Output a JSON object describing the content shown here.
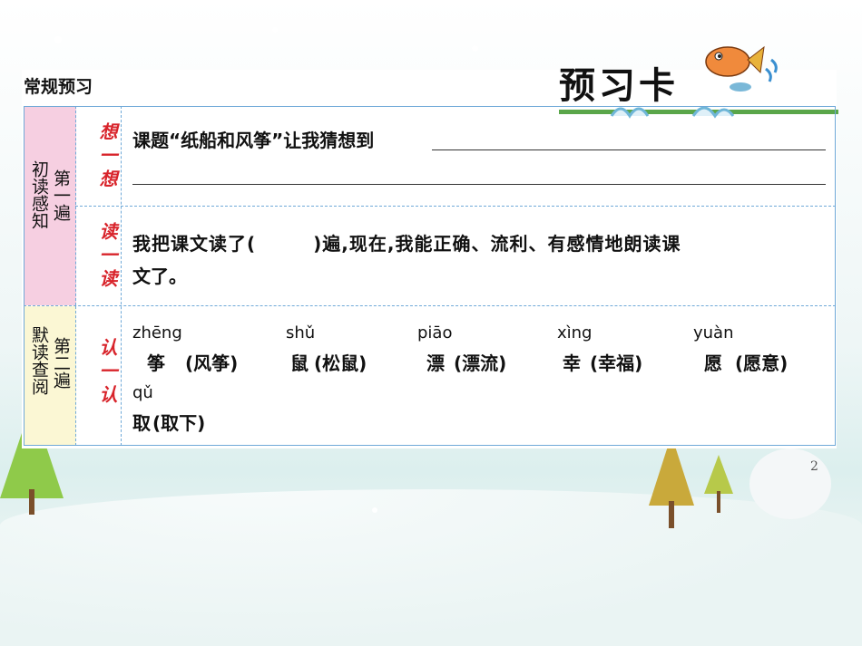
{
  "header": {
    "section_label": "常规预习",
    "title_logo": "预习卡"
  },
  "rows": {
    "pass1": {
      "label": "第一遍",
      "sublabel": "初读感知"
    },
    "pass2": {
      "label": "第二遍",
      "sublabel": "默读查阅"
    },
    "think": {
      "label": "想一想",
      "text": "课题“纸船和风筝”让我猜想到"
    },
    "read": {
      "label": "读一读",
      "line1": "我把课文读了(　　　)遍,现在,我能正确、流利、有感情地朗读课",
      "line2": "文了。"
    },
    "recognize": {
      "label": "认一认",
      "items": [
        {
          "pinyin": "zhēng",
          "char": "筝",
          "word": "(风筝)"
        },
        {
          "pinyin": "shǔ",
          "char": "鼠",
          "word": "(松鼠)"
        },
        {
          "pinyin": "piāo",
          "char": "漂",
          "word": "(漂流)"
        },
        {
          "pinyin": "xìng",
          "char": "幸",
          "word": "(幸福)"
        },
        {
          "pinyin": "yuàn",
          "char": "愿",
          "word": "(愿意)"
        },
        {
          "pinyin": "qǔ",
          "char": "取",
          "word": "(取下)"
        }
      ]
    }
  },
  "page_number": "2",
  "colors": {
    "pink": "#f6cfe1",
    "cream": "#fbf7d4",
    "border_blue": "#6fa9d8",
    "label_red": "#d8232a",
    "bar_green": "#5aa64a"
  }
}
